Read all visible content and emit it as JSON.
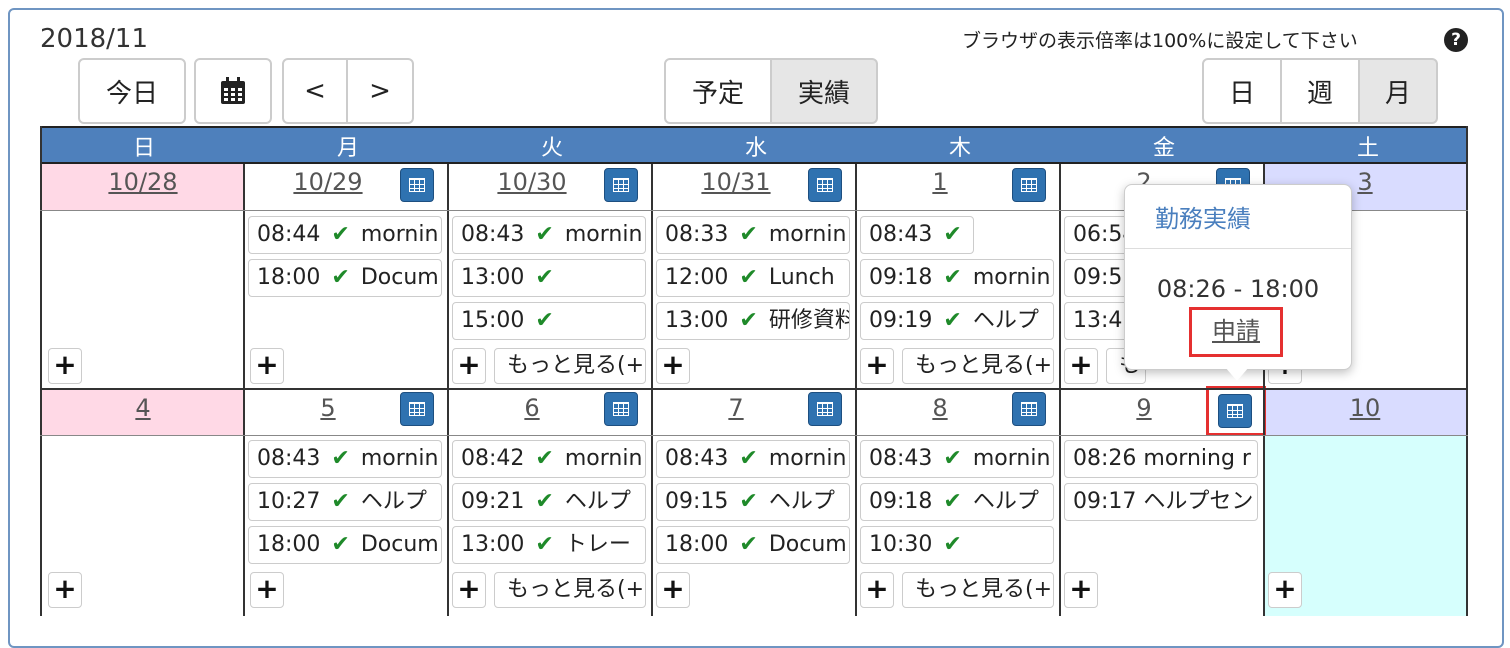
{
  "header": {
    "month": "2018/11",
    "note": "ブラウザの表示倍率は100%に設定して下さい",
    "help": "?"
  },
  "toolbar": {
    "today": "今日",
    "prev": "<",
    "next": ">",
    "plan": "予定",
    "actual": "実績",
    "day": "日",
    "week": "週",
    "month": "月"
  },
  "weekdays": [
    "日",
    "月",
    "火",
    "水",
    "木",
    "金",
    "土"
  ],
  "weeks": [
    {
      "dates": [
        "10/28",
        "10/29",
        "10/30",
        "10/31",
        "1",
        "2",
        "3"
      ],
      "events": [
        [],
        [
          "08:44 ✔ mornin",
          "18:00 ✔ Docum"
        ],
        [
          "08:43 ✔ mornin",
          "13:00 ✔ ",
          "15:00 ✔ "
        ],
        [
          "08:33 ✔ mornin",
          "12:00 ✔ Lunch",
          "13:00 ✔ 研修資料"
        ],
        [
          "08:43 ✔",
          "09:18 ✔ mornin",
          "09:19 ✔ ヘルプ"
        ],
        [
          "06:54",
          "09:5",
          "13:4"
        ],
        []
      ],
      "more": "もっと見る(+"
    },
    {
      "dates": [
        "4",
        "5",
        "6",
        "7",
        "8",
        "9",
        "10"
      ],
      "events": [
        [],
        [
          "08:43 ✔ mornin",
          "10:27 ✔ ヘルプ",
          "18:00 ✔ Docum"
        ],
        [
          "08:42 ✔ mornin",
          "09:21 ✔ ヘルプ",
          "13:00 ✔ トレー"
        ],
        [
          "08:43 ✔ mornin",
          "09:15 ✔ ヘルプ",
          "18:00 ✔ Docum"
        ],
        [
          "08:43 ✔ mornin",
          "09:18 ✔ ヘルプ",
          "10:30 ✔ "
        ],
        [
          "08:26 morning r",
          "09:17 ヘルプセン"
        ],
        []
      ],
      "more": "もっと見る(+"
    }
  ],
  "popup": {
    "title": "勤務実績",
    "time": "08:26 - 18:00",
    "apply": "申請"
  },
  "plus": "+",
  "colors": {
    "header_blue": "#4e80bc",
    "sunday_pink": "#ffd9e6",
    "saturday_lavender": "#d9dcff",
    "today_cyan": "#d6fffd",
    "check_green": "#1f8a2a",
    "highlight_red": "#e53030"
  }
}
